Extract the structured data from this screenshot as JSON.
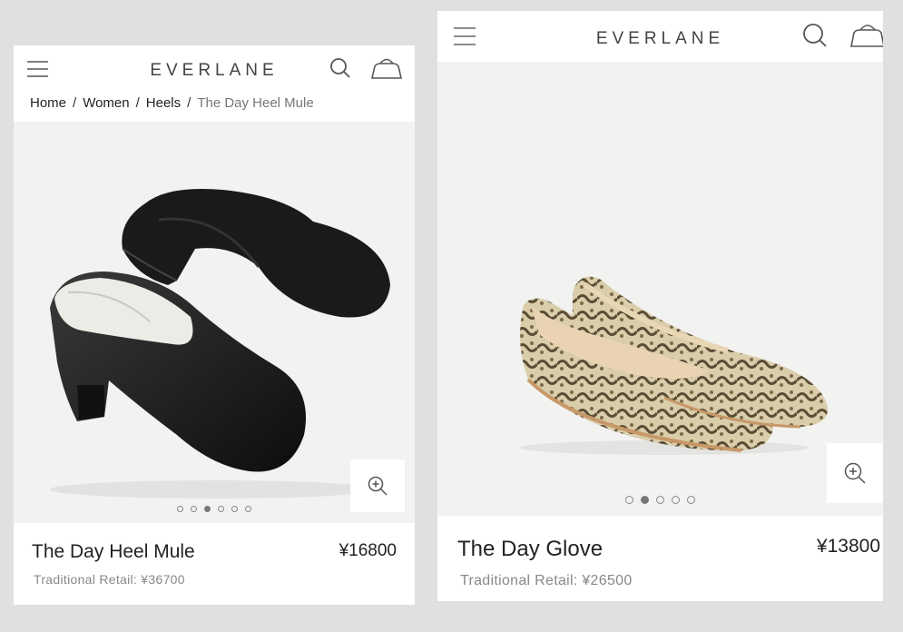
{
  "left": {
    "brand": "EVERLANE",
    "breadcrumb": [
      "Home",
      "Women",
      "Heels",
      "The Day Heel Mule"
    ],
    "breadcrumb_separator": "/",
    "product_name": "The Day Heel Mule",
    "price": "¥16800",
    "retail": "Traditional Retail: ¥36700",
    "carousel": {
      "count": 6,
      "active": 3
    }
  },
  "right": {
    "brand": "EVERLANE",
    "product_name": "The Day Glove",
    "price": "¥13800",
    "retail": "Traditional Retail: ¥26500",
    "carousel": {
      "count": 5,
      "active": 2
    }
  },
  "icons": {
    "menu": "hamburger-menu-icon",
    "search": "search-icon",
    "cart": "shopping-bag-icon",
    "zoom": "zoom-in-icon"
  },
  "colors": {
    "background": "#e0e0e0",
    "image_bg": "#f2f2f1",
    "text": "#222222",
    "muted": "#888888"
  }
}
